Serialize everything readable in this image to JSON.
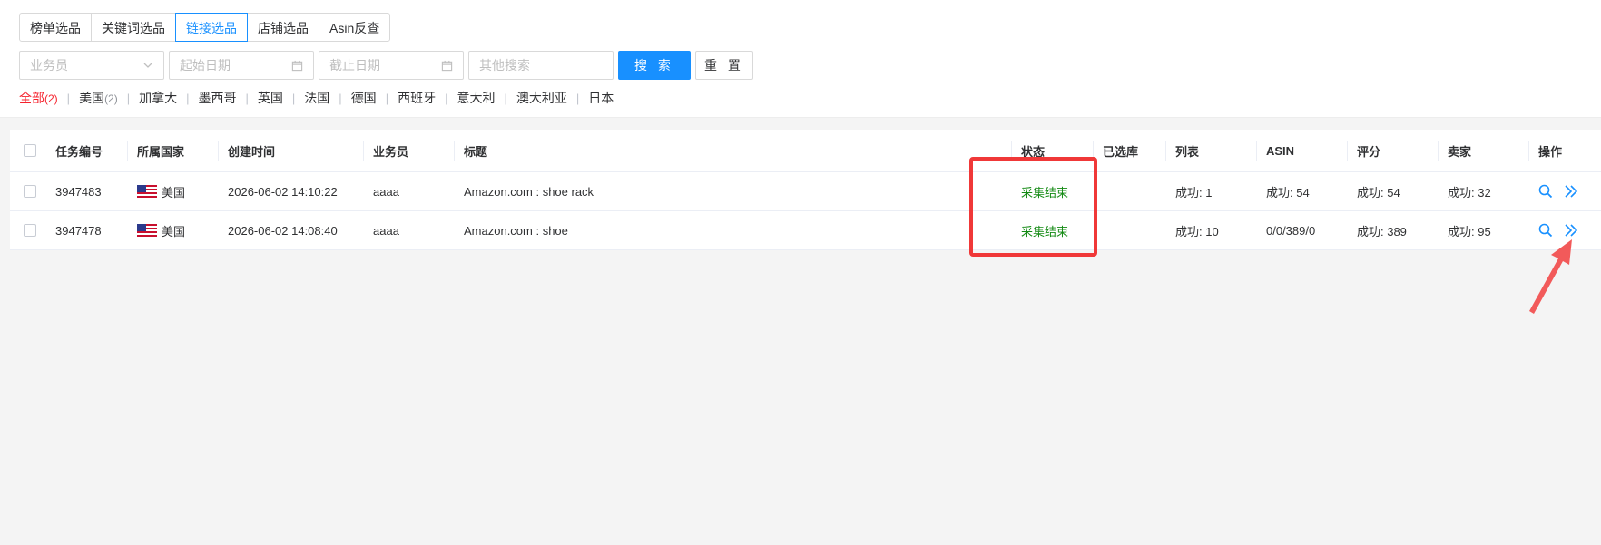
{
  "tabs": [
    "榜单选品",
    "关键词选品",
    "链接选品",
    "店铺选品",
    "Asin反查"
  ],
  "active_tab": "链接选品",
  "filters": {
    "salesperson_placeholder": "业务员",
    "start_date_placeholder": "起始日期",
    "end_date_placeholder": "截止日期",
    "other_search_placeholder": "其他搜索",
    "search_button": "搜 索",
    "reset_button": "重 置"
  },
  "countries": [
    {
      "label": "全部",
      "count": "(2)"
    },
    {
      "label": "美国",
      "count": "(2)"
    },
    {
      "label": "加拿大",
      "count": ""
    },
    {
      "label": "墨西哥",
      "count": ""
    },
    {
      "label": "英国",
      "count": ""
    },
    {
      "label": "法国",
      "count": ""
    },
    {
      "label": "德国",
      "count": ""
    },
    {
      "label": "西班牙",
      "count": ""
    },
    {
      "label": "意大利",
      "count": ""
    },
    {
      "label": "澳大利亚",
      "count": ""
    },
    {
      "label": "日本",
      "count": ""
    }
  ],
  "table": {
    "headers": {
      "task_id": "任务编号",
      "country": "所属国家",
      "created": "创建时间",
      "salesperson": "业务员",
      "title": "标题",
      "status": "状态",
      "selected_lib": "已选库",
      "list": "列表",
      "asin": "ASIN",
      "rating": "评分",
      "seller": "卖家",
      "ops": "操作"
    },
    "rows": [
      {
        "task_id": "3947483",
        "country": "美国",
        "created": "2026-06-02 14:10:22",
        "salesperson": "aaaa",
        "title": "Amazon.com : shoe rack",
        "status": "采集结束",
        "selected_lib": "",
        "list": "成功: 1",
        "asin": "成功: 54",
        "rating": "成功: 54",
        "seller": "成功: 32"
      },
      {
        "task_id": "3947478",
        "country": "美国",
        "created": "2026-06-02 14:08:40",
        "salesperson": "aaaa",
        "title": "Amazon.com : shoe",
        "status": "采集结束",
        "selected_lib": "",
        "list": "成功: 10",
        "asin": "0/0/389/0",
        "rating": "成功: 389",
        "seller": "成功: 95"
      }
    ]
  },
  "colors": {
    "accent": "#1890ff",
    "status_done": "#138a13",
    "active_country": "#f5222d",
    "annotation": "#f03838"
  },
  "icons": {
    "select_arrow": "chevron-down-icon",
    "date": "calendar-icon",
    "view": "search-icon",
    "more": "double-chevron-right-icon"
  }
}
